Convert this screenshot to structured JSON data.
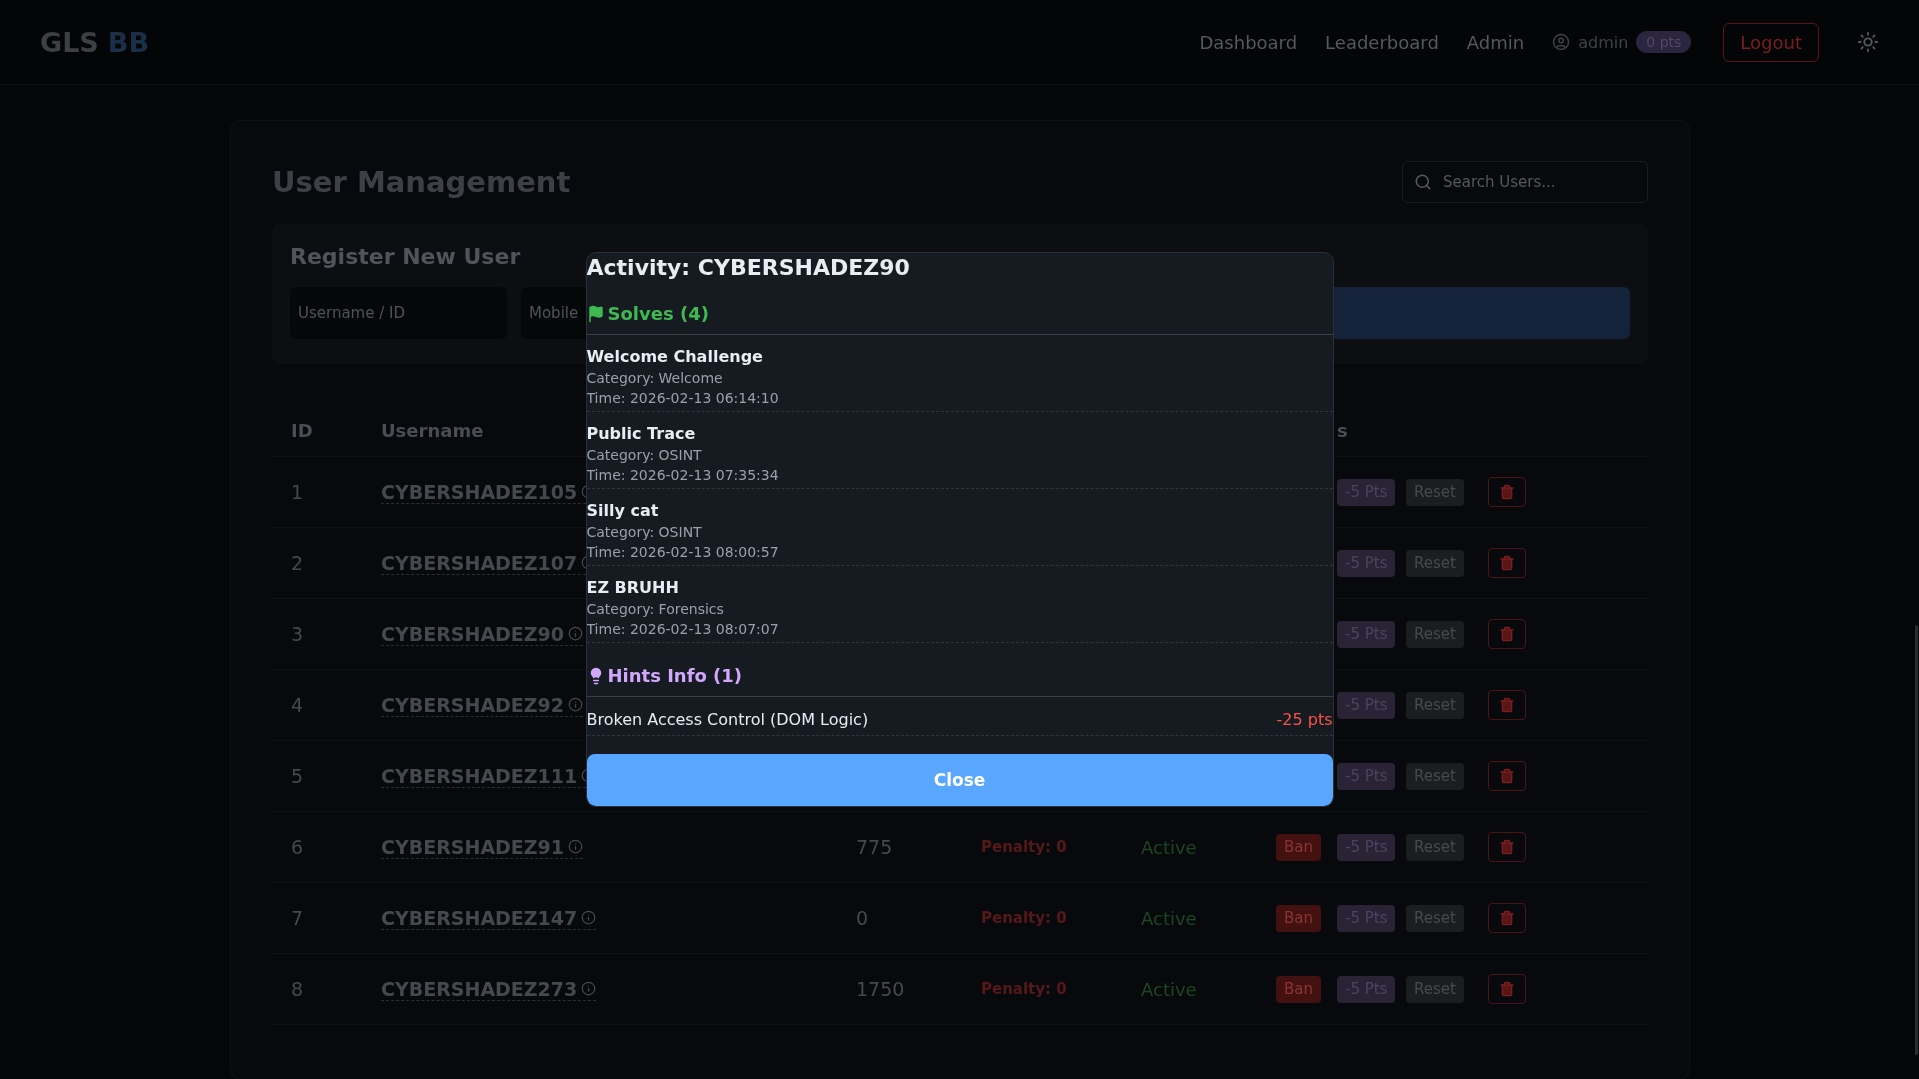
{
  "header": {
    "logo": {
      "part_1": "GLS",
      "part_2": "BB"
    },
    "nav": [
      {
        "label": "Dashboard"
      },
      {
        "label": "Leaderboard"
      },
      {
        "label": "Admin"
      }
    ],
    "user": {
      "name": "admin",
      "points": "0 pts"
    },
    "logout": "Logout"
  },
  "page": {
    "title": "User Management",
    "search": {
      "placeholder": "Search Users..."
    },
    "register": {
      "title": "Register New User",
      "fields": [
        {
          "placeholder": "Username / ID"
        },
        {
          "placeholder": "Mobile"
        }
      ]
    },
    "table": {
      "columns": [
        {
          "label": "ID"
        },
        {
          "label": "Username"
        },
        {
          "label": "s"
        }
      ],
      "rows": [
        {
          "id": "1",
          "username": "CYBERSHADEZ105",
          "pts": "-5 Pts",
          "reset": "Reset"
        },
        {
          "id": "2",
          "username": "CYBERSHADEZ107",
          "pts": "-5 Pts",
          "reset": "Reset"
        },
        {
          "id": "3",
          "username": "CYBERSHADEZ90",
          "pts": "-5 Pts",
          "reset": "Reset"
        },
        {
          "id": "4",
          "username": "CYBERSHADEZ92",
          "pts": "-5 Pts",
          "reset": "Reset"
        },
        {
          "id": "5",
          "username": "CYBERSHADEZ111",
          "pts": "-5 Pts",
          "reset": "Reset"
        },
        {
          "id": "6",
          "username": "CYBERSHADEZ91",
          "score": "775",
          "penalty": "Penalty: 0",
          "status": "Active",
          "ban": "Ban",
          "pts": "-5 Pts",
          "reset": "Reset"
        },
        {
          "id": "7",
          "username": "CYBERSHADEZ147",
          "score": "0",
          "penalty": "Penalty: 0",
          "status": "Active",
          "ban": "Ban",
          "pts": "-5 Pts",
          "reset": "Reset"
        },
        {
          "id": "8",
          "username": "CYBERSHADEZ273",
          "score": "1750",
          "penalty": "Penalty: 0",
          "status": "Active",
          "ban": "Ban",
          "pts": "-5 Pts",
          "reset": "Reset"
        }
      ]
    }
  },
  "modal": {
    "title": "Activity: CYBERSHADEZ90",
    "solves": {
      "heading": "Solves (4)",
      "items": [
        {
          "name": "Welcome Challenge",
          "category": "Category: Welcome",
          "time": "Time: 2026-02-13 06:14:10"
        },
        {
          "name": "Public Trace",
          "category": "Category: OSINT",
          "time": "Time: 2026-02-13 07:35:34"
        },
        {
          "name": "Silly cat",
          "category": "Category: OSINT",
          "time": "Time: 2026-02-13 08:00:57"
        },
        {
          "name": "EZ BRUHH",
          "category": "Category: Forensics",
          "time": "Time: 2026-02-13 08:07:07"
        }
      ]
    },
    "hints": {
      "heading": "Hints Info (1)",
      "items": [
        {
          "name": "Broken Access Control (DOM Logic)",
          "cost": "-25 pts"
        }
      ]
    },
    "close": "Close"
  }
}
